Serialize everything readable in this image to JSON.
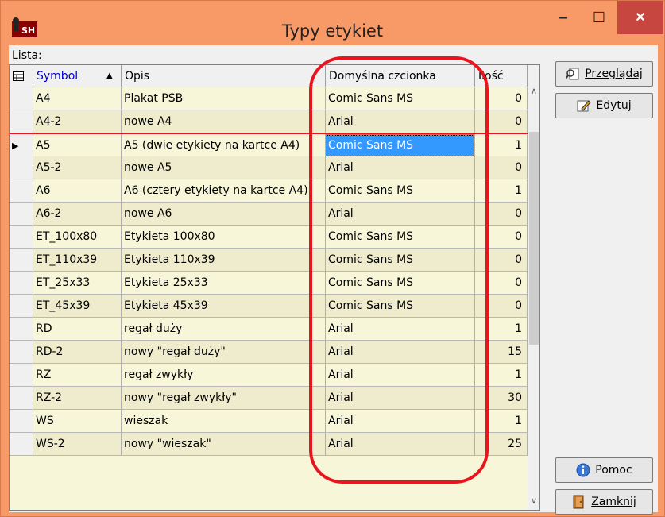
{
  "window": {
    "title": "Typy etykiet",
    "app_icon": "SH",
    "min_glyph": "–",
    "max_glyph": "☐",
    "close_glyph": "✕"
  },
  "list_label": "Lista:",
  "columns": {
    "symbol": "Symbol",
    "opis": "Opis",
    "font": "Domyślna czcionka",
    "qty": "Ilość"
  },
  "rows": [
    {
      "symbol": "A4",
      "opis": "Plakat PSB",
      "font": "Comic Sans MS",
      "qty": "0"
    },
    {
      "symbol": "A4-2",
      "opis": "nowe A4",
      "font": "Arial",
      "qty": "0"
    },
    {
      "symbol": "A5",
      "opis": "A5 (dwie etykiety na kartce A4)",
      "font": "Comic Sans MS",
      "qty": "1",
      "selected": true
    },
    {
      "symbol": "A5-2",
      "opis": "nowe A5",
      "font": "Arial",
      "qty": "0"
    },
    {
      "symbol": "A6",
      "opis": "A6 (cztery etykiety na kartce A4)",
      "font": "Comic Sans MS",
      "qty": "1"
    },
    {
      "symbol": "A6-2",
      "opis": "nowe A6",
      "font": "Arial",
      "qty": "0"
    },
    {
      "symbol": "ET_100x80",
      "opis": "Etykieta 100x80",
      "font": "Comic Sans MS",
      "qty": "0"
    },
    {
      "symbol": "ET_110x39",
      "opis": "Etykieta 110x39",
      "font": "Comic Sans MS",
      "qty": "0"
    },
    {
      "symbol": "ET_25x33",
      "opis": "Etykieta 25x33",
      "font": "Comic Sans MS",
      "qty": "0"
    },
    {
      "symbol": "ET_45x39",
      "opis": "Etykieta 45x39",
      "font": "Comic Sans MS",
      "qty": "0"
    },
    {
      "symbol": "RD",
      "opis": "regał duży",
      "font": "Arial",
      "qty": "1"
    },
    {
      "symbol": "RD-2",
      "opis": "nowy \"regał duży\"",
      "font": "Arial",
      "qty": "15"
    },
    {
      "symbol": "RZ",
      "opis": "regał zwykły",
      "font": "Arial",
      "qty": "1"
    },
    {
      "symbol": "RZ-2",
      "opis": "nowy \"regał zwykły\"",
      "font": "Arial",
      "qty": "30"
    },
    {
      "symbol": "WS",
      "opis": "wieszak",
      "font": "Arial",
      "qty": "1"
    },
    {
      "symbol": "WS-2",
      "opis": "nowy \"wieszak\"",
      "font": "Arial",
      "qty": "25"
    }
  ],
  "buttons": {
    "browse": "Przeglądaj",
    "edit": "Edytuj",
    "help": "Pomoc",
    "close": "Zamknij"
  },
  "colors": {
    "titlebar": "#f89a68",
    "close_button": "#c7463f",
    "grid_row_a": "#f8f6d8",
    "grid_row_b": "#eeeccd",
    "selection": "#3399ff",
    "annotation_oval": "#e8141e"
  }
}
